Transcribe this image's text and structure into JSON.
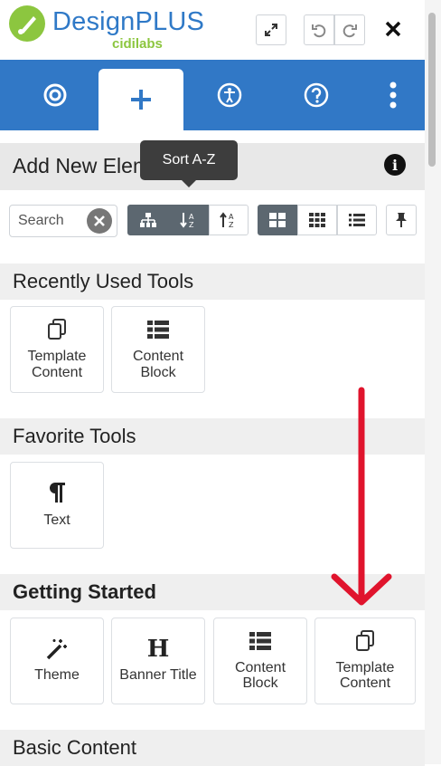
{
  "brand": {
    "name": "DesignPLUS",
    "sub": "cidilabs",
    "logo_color": "#8cc63f",
    "title_color": "#2f79c7"
  },
  "header": {
    "expand_icon": "expand-icon",
    "undo_icon": "undo-icon",
    "redo_icon": "redo-icon",
    "close_icon": "close-icon"
  },
  "tabs": [
    {
      "icon": "target-icon",
      "active": false
    },
    {
      "icon": "plus-icon",
      "active": true
    },
    {
      "icon": "accessibility-icon",
      "active": false
    },
    {
      "icon": "help-icon",
      "active": false
    },
    {
      "icon": "more-vertical-icon",
      "active": false
    }
  ],
  "tab_bar_color": "#3178c6",
  "panel": {
    "title": "Add New Elements",
    "tooltip": "Sort A-Z"
  },
  "search": {
    "placeholder": "Search"
  },
  "sort_buttons": [
    {
      "icon": "hierarchy-icon",
      "active": true
    },
    {
      "icon": "sort-a-z-icon",
      "active": true
    },
    {
      "icon": "sort-z-a-icon",
      "active": false
    }
  ],
  "view_buttons": [
    {
      "icon": "large-grid-icon",
      "active": true
    },
    {
      "icon": "small-grid-icon",
      "active": false
    },
    {
      "icon": "list-icon",
      "active": false
    }
  ],
  "pin_icon": "pin-icon",
  "sections": {
    "recent": {
      "label": "Recently Used Tools",
      "tools": [
        {
          "line1": "Template",
          "line2": "Content",
          "icon": "copy-icon"
        },
        {
          "line1": "Content",
          "line2": "Block",
          "icon": "block-list-icon"
        }
      ]
    },
    "favorite": {
      "label": "Favorite Tools",
      "tools": [
        {
          "line1": "Text",
          "line2": "",
          "icon": "pilcrow-icon"
        }
      ]
    },
    "getting_started": {
      "label": "Getting Started",
      "tools": [
        {
          "line1": "Theme",
          "line2": "",
          "icon": "magic-wand-icon"
        },
        {
          "line1": "Banner Title",
          "line2": "",
          "icon": "heading-icon"
        },
        {
          "line1": "Content",
          "line2": "Block",
          "icon": "block-list-icon"
        },
        {
          "line1": "Template",
          "line2": "Content",
          "icon": "copy-icon"
        }
      ]
    },
    "basic": {
      "label": "Basic Content"
    }
  },
  "annotation_color": "#e0142d"
}
